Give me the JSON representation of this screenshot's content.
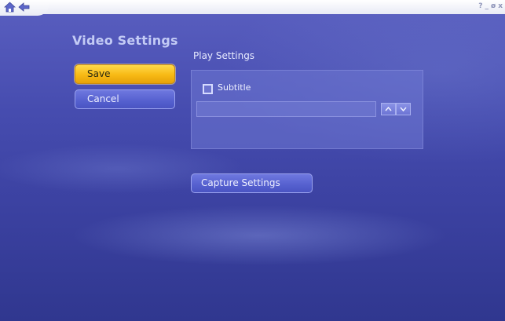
{
  "window": {
    "controls": [
      "?",
      "_",
      "ø",
      "x"
    ]
  },
  "page": {
    "title": "Video Settings"
  },
  "actions": {
    "save_label": "Save",
    "cancel_label": "Cancel"
  },
  "play_settings": {
    "section_label": "Play Settings",
    "subtitle_label": "Subtitle",
    "subtitle_checked": false,
    "subtitle_value": ""
  },
  "capture": {
    "button_label": "Capture Settings"
  },
  "colors": {
    "accent_selected": "#f7b914",
    "button_blue": "#5560cf",
    "background": "#464caf"
  },
  "icons": [
    "home-icon",
    "back-arrow-icon",
    "up-arrow-icon",
    "down-arrow-icon"
  ]
}
